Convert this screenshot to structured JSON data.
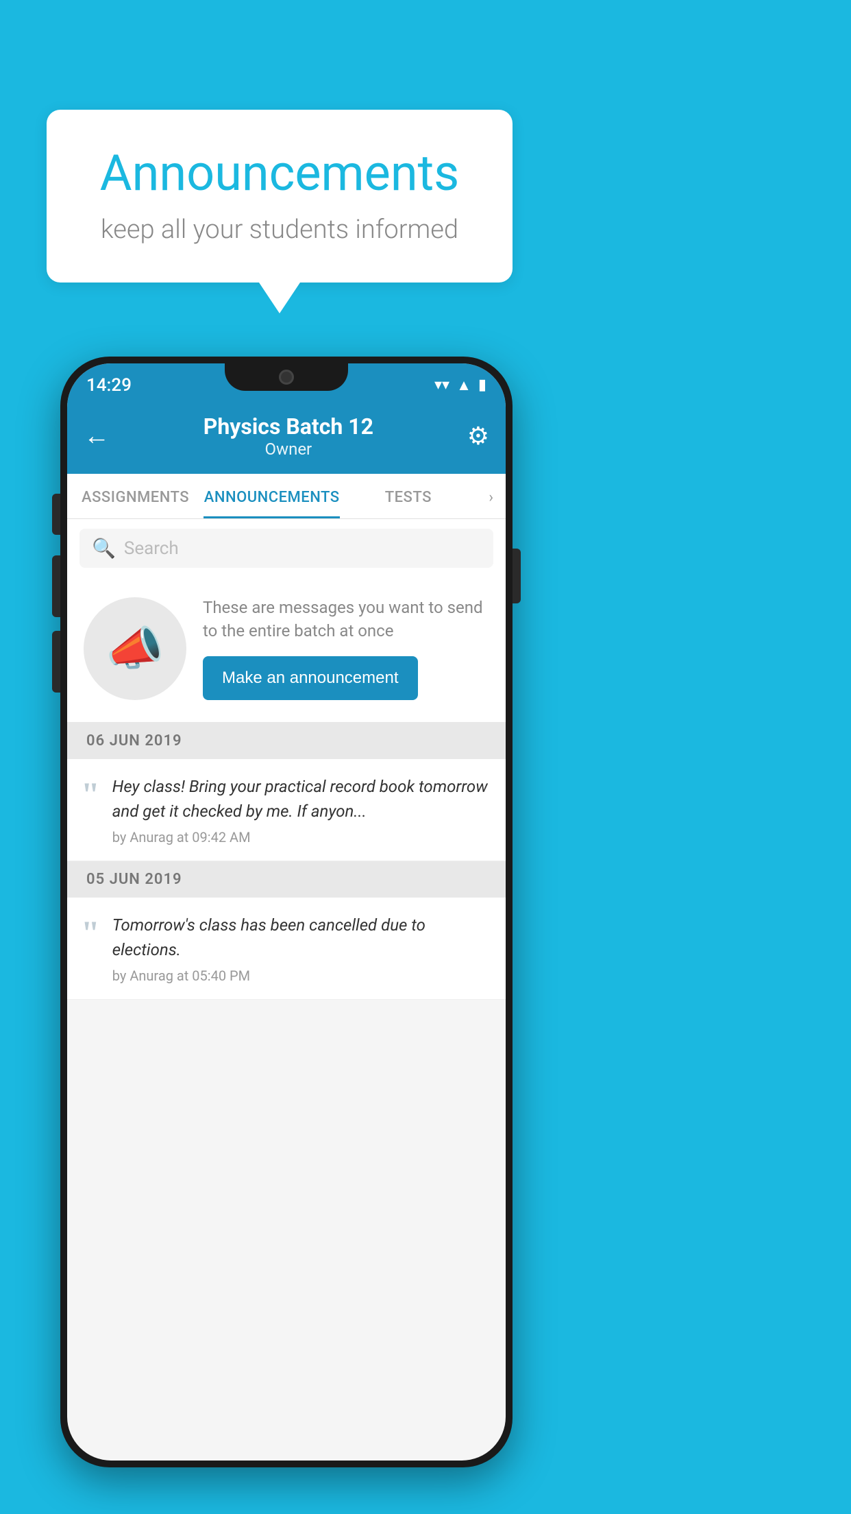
{
  "background_color": "#1BB8E0",
  "speech_bubble": {
    "title": "Announcements",
    "subtitle": "keep all your students informed"
  },
  "status_bar": {
    "time": "14:29",
    "icons": [
      "wifi",
      "signal",
      "battery"
    ]
  },
  "header": {
    "title": "Physics Batch 12",
    "subtitle": "Owner",
    "back_label": "←",
    "gear_label": "⚙"
  },
  "tabs": [
    {
      "label": "ASSIGNMENTS",
      "active": false
    },
    {
      "label": "ANNOUNCEMENTS",
      "active": true
    },
    {
      "label": "TESTS",
      "active": false
    },
    {
      "label": "›",
      "active": false
    }
  ],
  "search": {
    "placeholder": "Search"
  },
  "announce_prompt": {
    "description": "These are messages you want to send to the entire batch at once",
    "button_label": "Make an announcement"
  },
  "announcements": [
    {
      "date": "06  JUN  2019",
      "text": "Hey class! Bring your practical record book tomorrow and get it checked by me. If anyon...",
      "meta": "by Anurag at 09:42 AM"
    },
    {
      "date": "05  JUN  2019",
      "text": "Tomorrow's class has been cancelled due to elections.",
      "meta": "by Anurag at 05:40 PM"
    }
  ]
}
